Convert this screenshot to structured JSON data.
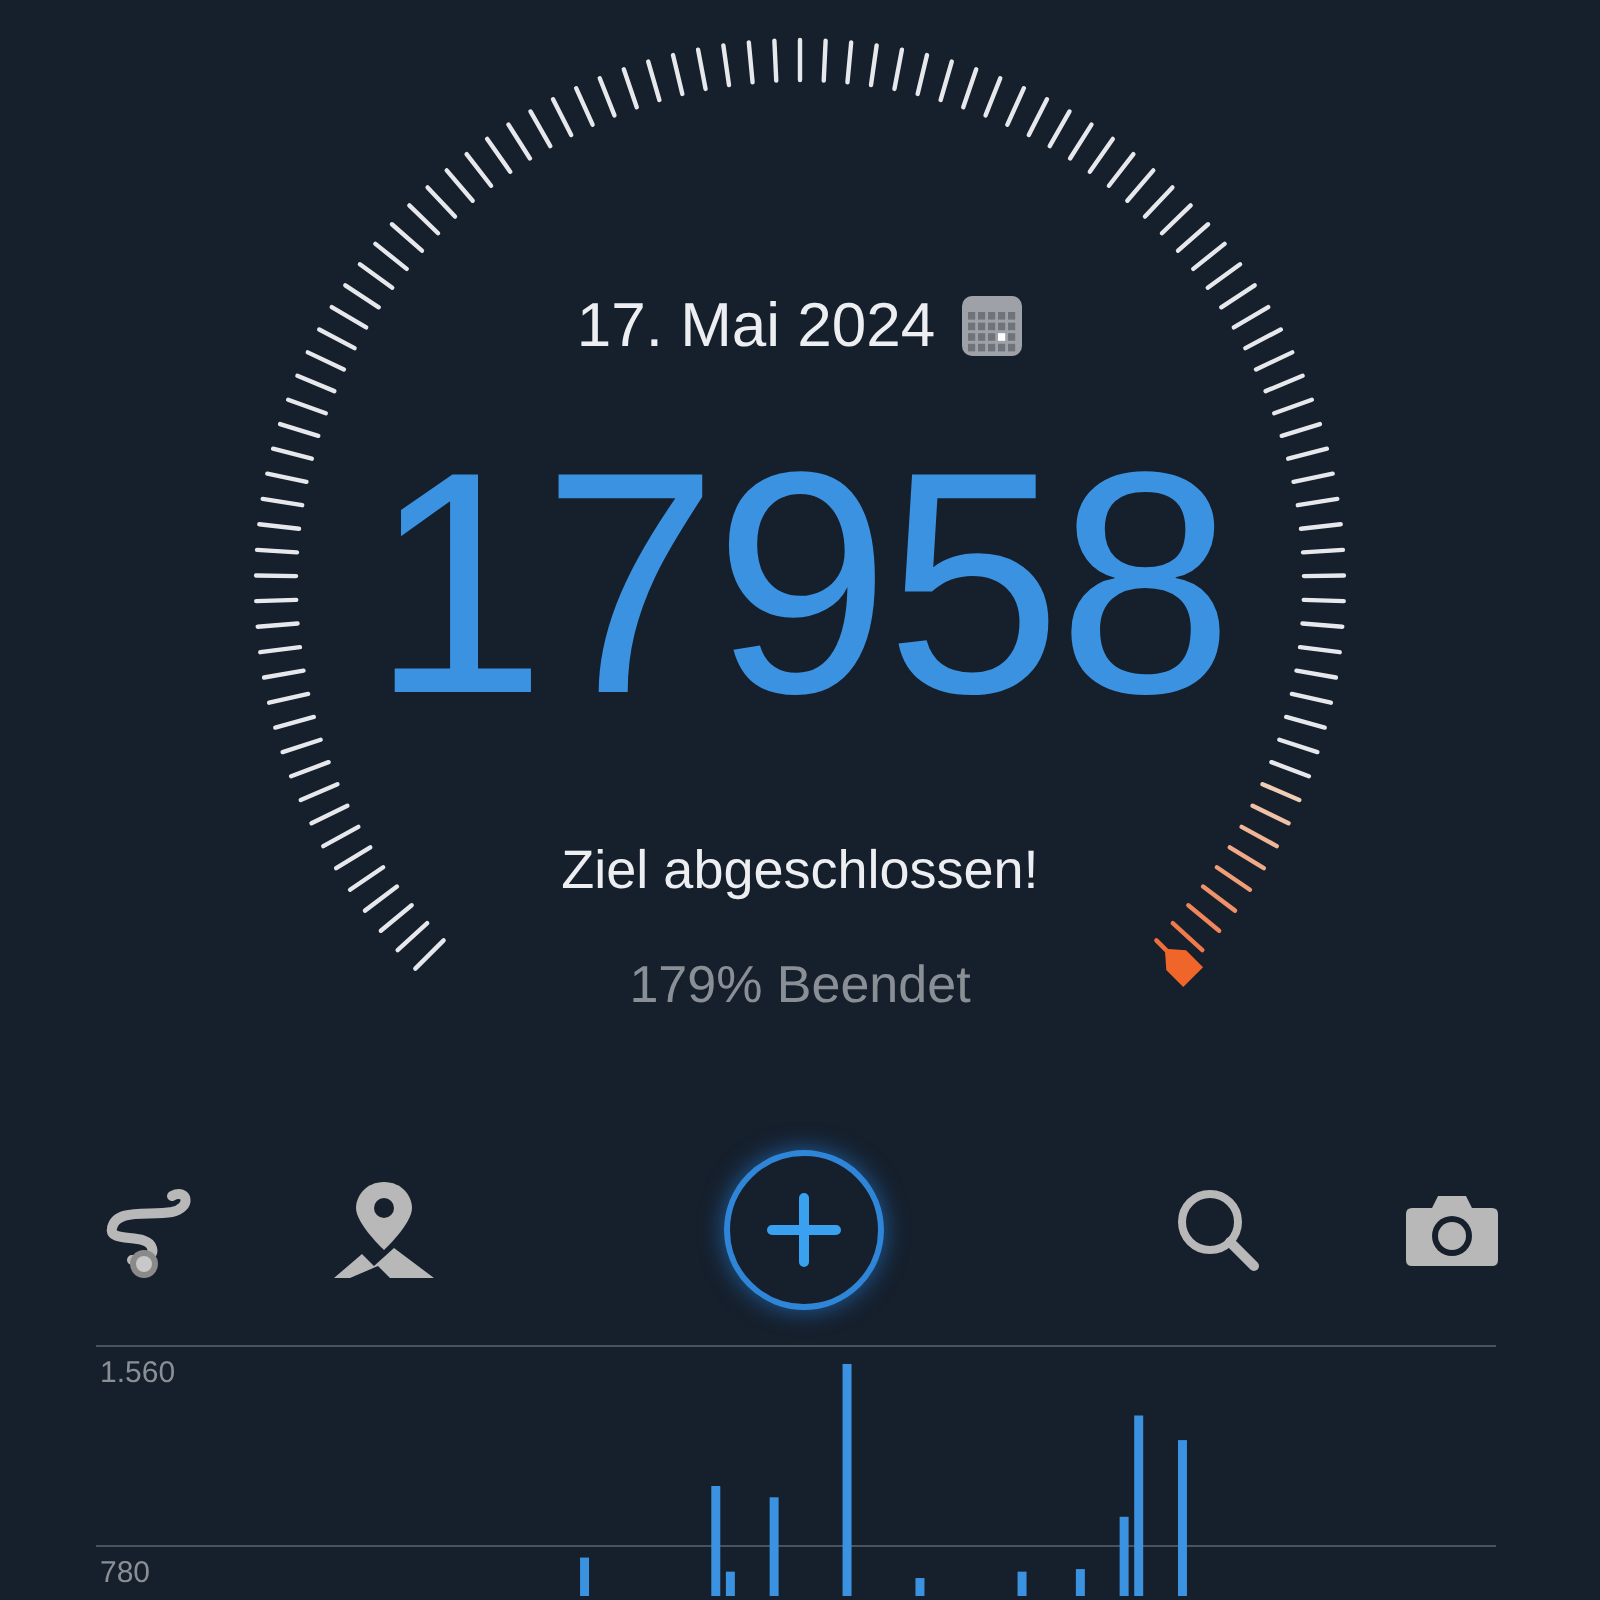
{
  "date": "17. Mai 2024",
  "steps": "17958",
  "goal_message": "Ziel abgeschlossen!",
  "progress_text": "179% Beendet",
  "toolbar": [
    {
      "kind": "route"
    },
    {
      "kind": "map"
    },
    {
      "kind": "add"
    },
    {
      "kind": "search"
    },
    {
      "kind": "camera"
    }
  ],
  "chart_data": {
    "type": "bar",
    "ylim": [
      0,
      1560
    ],
    "yticks": [
      {
        "value": 1560,
        "label": "1.560"
      },
      {
        "value": 780,
        "label": "780"
      }
    ],
    "categories": [
      null,
      null,
      null,
      null,
      null,
      null,
      null,
      null,
      null,
      null,
      null,
      null,
      null,
      null,
      null,
      null,
      null,
      null,
      null,
      null,
      null,
      null,
      null,
      null,
      null,
      null,
      null,
      null,
      null,
      null,
      null,
      null,
      null,
      null,
      null,
      null,
      null,
      null,
      null,
      null,
      null,
      null,
      null,
      null,
      null,
      null,
      null,
      null,
      null,
      null,
      null,
      null,
      null,
      null,
      null,
      null,
      null,
      null,
      null,
      null,
      null,
      null,
      null,
      null,
      null,
      null,
      null,
      null,
      null,
      null,
      null,
      null,
      null,
      null,
      null,
      null,
      null,
      null,
      null,
      null,
      null,
      null,
      null,
      null,
      null,
      null,
      null,
      null,
      null,
      null,
      null,
      null,
      null,
      null,
      null,
      null
    ],
    "series": [
      {
        "color": "#3a92e0",
        "values": [
          0,
          0,
          0,
          0,
          0,
          0,
          0,
          0,
          0,
          0,
          0,
          0,
          0,
          0,
          0,
          0,
          0,
          0,
          0,
          0,
          0,
          0,
          0,
          0,
          0,
          0,
          0,
          0,
          0,
          0,
          0,
          0,
          0,
          735,
          0,
          0,
          0,
          0,
          0,
          0,
          0,
          0,
          1014,
          680,
          0,
          0,
          970,
          0,
          0,
          0,
          0,
          1490,
          0,
          0,
          0,
          0,
          655,
          0,
          0,
          0,
          0,
          0,
          0,
          680,
          0,
          0,
          0,
          690,
          0,
          0,
          894,
          1289,
          0,
          0,
          1193,
          0,
          0,
          0,
          0,
          0,
          0,
          0,
          0,
          0,
          0,
          0,
          0,
          0,
          0,
          0,
          0,
          0,
          0,
          0,
          0,
          0
        ]
      }
    ]
  }
}
